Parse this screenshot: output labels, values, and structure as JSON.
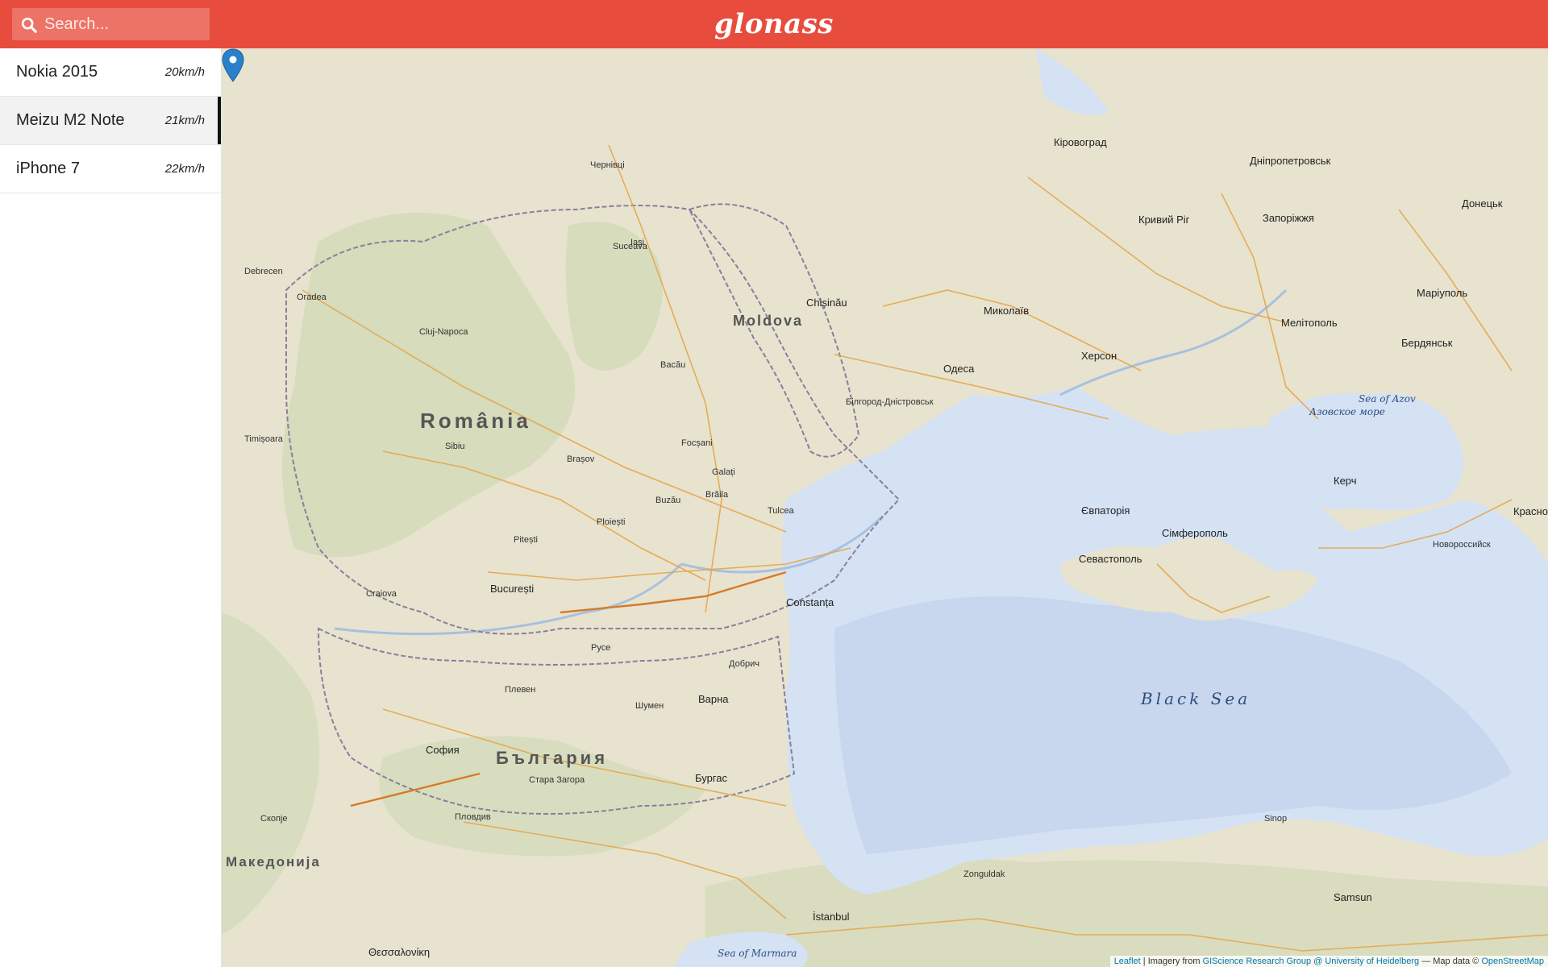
{
  "header": {
    "title": "glonass",
    "search_placeholder": "Search...",
    "search_value": "",
    "color": "#e84c3d"
  },
  "devices": [
    {
      "name": "Nokia 2015",
      "speed": "20km/h",
      "active": false
    },
    {
      "name": "Meizu M2 Note",
      "speed": "21km/h",
      "active": true
    },
    {
      "name": "iPhone 7",
      "speed": "22km/h",
      "active": false
    }
  ],
  "map": {
    "marker_icon": "map-marker-icon",
    "marker_color": "#2a81cb",
    "labels": {
      "romania": "România",
      "moldova": "Moldova",
      "bulgaria": "България",
      "macedonia": "Македонија",
      "black_sea": "Black Sea",
      "sea_of_azov": "Sea of Azov",
      "azov_ru": "Азовское море",
      "sea_of_marmara": "Sea of Marmara",
      "bucuresti": "București",
      "chisinau": "Chișinău",
      "odesa": "Одеса",
      "constanta": "Constanța",
      "sofia": "София",
      "istanbul": "İstanbul",
      "varna": "Варна",
      "burgas": "Бургас",
      "sevastopol": "Севастополь",
      "simferopol": "Сімферополь",
      "yevpatoriya": "Євпаторія",
      "kherson": "Херсон",
      "mykolaiv": "Миколаїв",
      "zaporizhzhia": "Запоріжжя",
      "dnipropetrovsk": "Дніпропетровськ",
      "kryvyi_rih": "Кривий Ріг",
      "kirovohrad": "Кіровоград",
      "melitopol": "Мелітополь",
      "berdiansk": "Бердянськ",
      "mariupol": "Маріуполь",
      "donetsk": "Донецьк",
      "kerch": "Керч",
      "krasnodar": "Красно",
      "novorossiysk": "Новороссийск",
      "iasi": "Iași",
      "cluj": "Cluj-Napoca",
      "timisoara": "Timișoara",
      "brasov": "Brașov",
      "craiova": "Craiova",
      "galati": "Galați",
      "braila": "Brăila",
      "ploiesti": "Ploiești",
      "pitesti": "Pitești",
      "sibiu": "Sibiu",
      "oradea": "Oradea",
      "bacau": "Bacău",
      "suceava": "Suceava",
      "chernivtsi": "Чернівці",
      "focsani": "Focșani",
      "buzau": "Buzău",
      "tulcea": "Tulcea",
      "samsun": "Samsun",
      "zonguldak": "Zonguldak",
      "plovdiv": "Пловдив",
      "skopje": "Скопје",
      "thessaloniki": "Θεσσαλονίκη",
      "debrecen": "Debrecen",
      "dobrich": "Добрич",
      "ruse": "Русе",
      "pleven": "Плевен",
      "shumen": "Шумен",
      "stara_zagora": "Стара Загора",
      "sinop": "Sinop",
      "bilhorod": "Білгород-Дністровськ"
    },
    "attribution": {
      "leaflet": "Leaflet",
      "imagery": "| Imagery from",
      "giscience": "GIScience Research Group @ University of Heidelberg",
      "mapdata": "— Map data ©",
      "osm": "OpenStreetMap"
    }
  }
}
